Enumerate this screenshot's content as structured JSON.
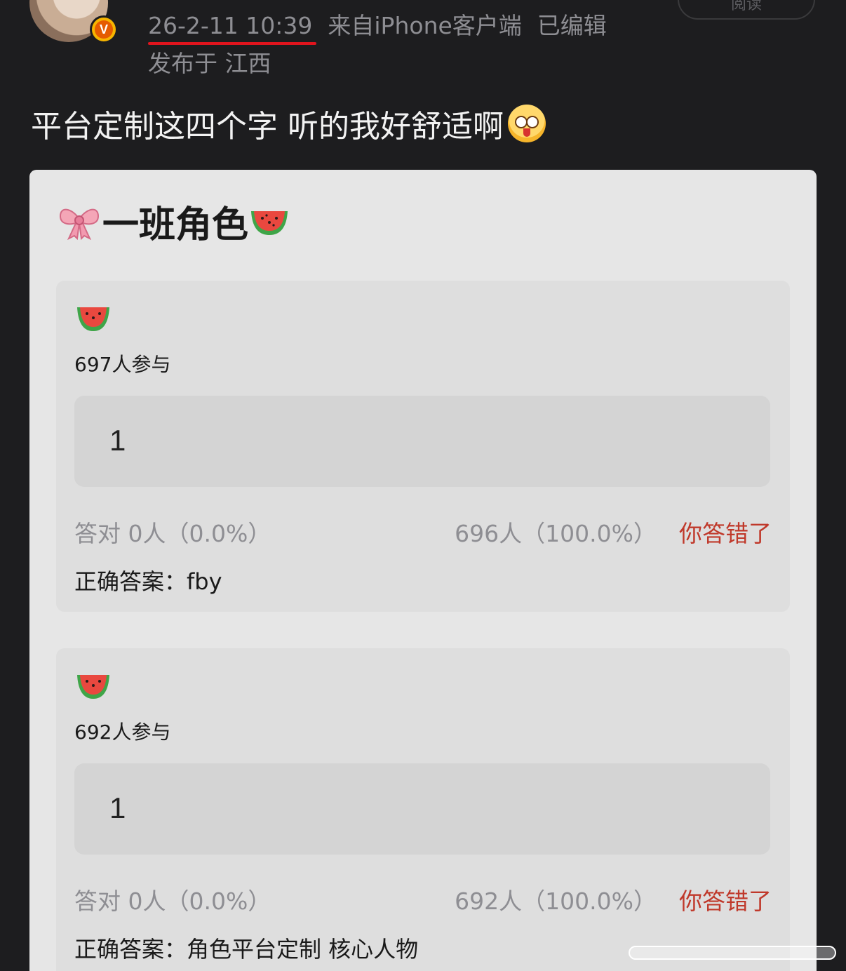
{
  "post": {
    "time": "26-2-11 10:39",
    "source": "来自iPhone客户端",
    "edited": "已编辑",
    "location": "发布于 江西",
    "read_label": "阅读",
    "text": "平台定制这四个字 听的我好舒适啊",
    "emoji": "drooling-face"
  },
  "quiz": {
    "title": "一班角色",
    "title_icons": [
      "ribbon-bow-icon",
      "watermelon-icon"
    ],
    "questions": [
      {
        "icon": "watermelon-icon",
        "participants": "697人参与",
        "answer": "1",
        "correct_stat": "答对  0人（0.0%）",
        "wrong_stat": "696人（100.0%）",
        "wrong_label": "你答错了",
        "correct_answer": "正确答案：fby"
      },
      {
        "icon": "watermelon-icon",
        "participants": "692人参与",
        "answer": "1",
        "correct_stat": "答对  0人（0.0%）",
        "wrong_stat": "692人（100.0%）",
        "wrong_label": "你答错了",
        "correct_answer": "正确答案：角色平台定制 核心人物"
      }
    ]
  },
  "colors": {
    "background": "#1d1d1f",
    "card": "#e6e6e6",
    "wrong": "#c0392b",
    "underline": "#e0141d",
    "verified": "#f7b500"
  }
}
